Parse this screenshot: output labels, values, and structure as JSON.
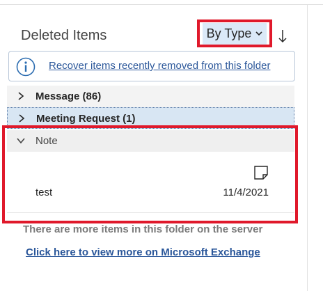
{
  "folder": {
    "title": "Deleted Items"
  },
  "sort": {
    "label": "By Type",
    "direction_icon": "arrow-down-icon"
  },
  "info_banner": {
    "icon": "info-icon",
    "link_text": "Recover items recently removed from this folder"
  },
  "groups": [
    {
      "label": "Message (86)",
      "expanded": false
    },
    {
      "label": "Meeting Request (1)",
      "expanded": false,
      "selected": true
    },
    {
      "label": "Note",
      "expanded": true
    }
  ],
  "note_items": [
    {
      "subject": "test",
      "date": "11/4/2021",
      "icon": "note-icon"
    }
  ],
  "footer": {
    "server_message": "There are more items in this folder on the server",
    "exchange_link": "Click here to view more on Microsoft Exchange"
  },
  "colors": {
    "highlight": "#e0192b",
    "link": "#2b579a",
    "selected_row": "#d8e6f3",
    "sort_bg": "#dbe9f8"
  }
}
